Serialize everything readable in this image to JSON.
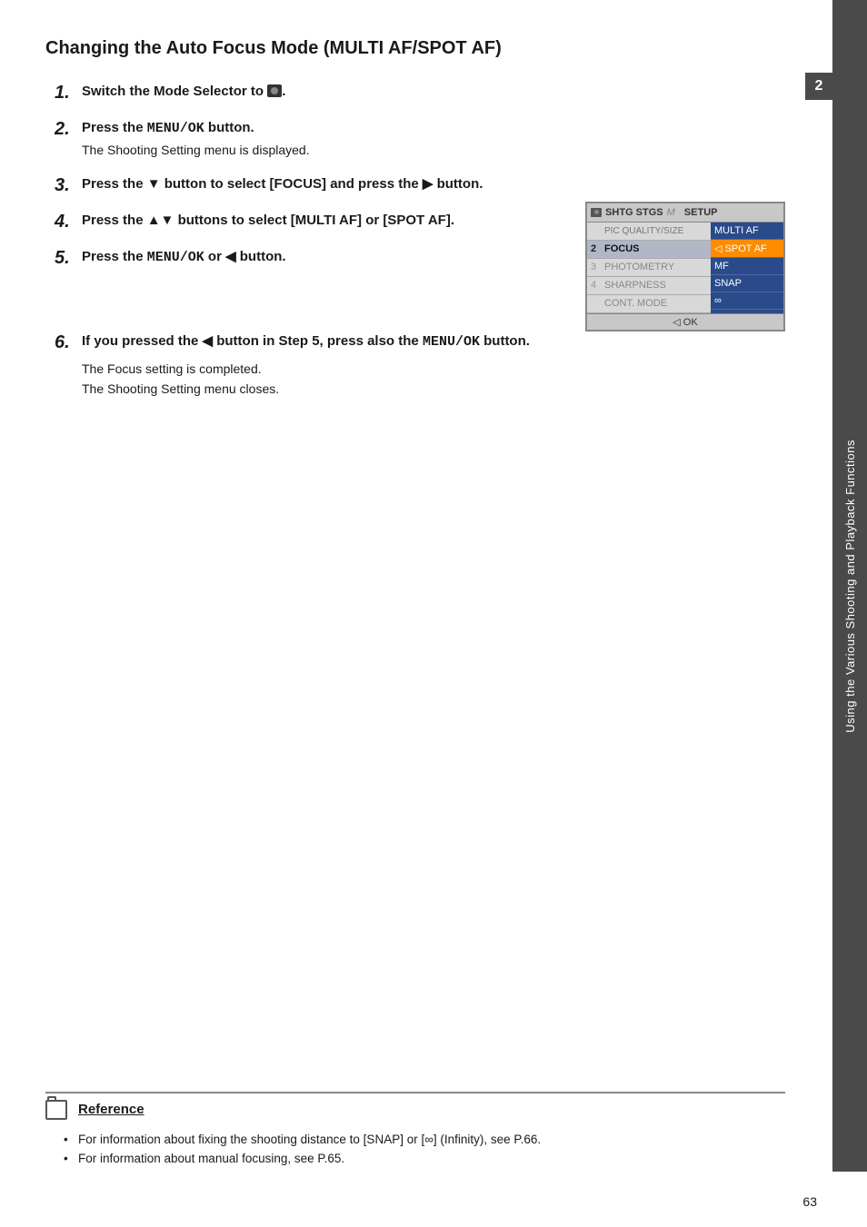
{
  "page": {
    "title": "Changing the Auto Focus Mode (MULTI AF/SPOT AF)",
    "page_number": "63",
    "sidebar_text": "Using the Various Shooting and Playback Functions",
    "sidebar_number": "2"
  },
  "steps": [
    {
      "number": "1.",
      "text": "Switch the Mode Selector to",
      "icon": "camera-still-icon",
      "suffix": "."
    },
    {
      "number": "2.",
      "main": "Press the",
      "mono": "MENU/OK",
      "suffix": " button.",
      "sub": "The Shooting Setting menu is displayed."
    },
    {
      "number": "3.",
      "text": "Press the ▼ button to select [FOCUS] and press the ▶ button."
    },
    {
      "number": "4.",
      "text": "Press the ▲▼ buttons to select [MULTI AF] or [SPOT AF]."
    },
    {
      "number": "5.",
      "main": "Press the",
      "mono": "MENU/OK",
      "or": " or ◀ button."
    },
    {
      "number": "6.",
      "main": "If you pressed the ◀ button in Step 5, press also the",
      "mono": "MENU/OK",
      "suffix": " button.",
      "sub1": "The Focus setting is completed.",
      "sub2": "The Shooting Setting menu closes."
    }
  ],
  "menu": {
    "header_tabs": [
      "SHTG STGS",
      "M",
      "SETUP"
    ],
    "rows_left": [
      {
        "num": "",
        "label": "PIC QUALITY/SIZE"
      },
      {
        "num": "2",
        "label": "FOCUS",
        "highlighted": true
      },
      {
        "num": "3",
        "label": "PHOTOMETRY"
      },
      {
        "num": "4",
        "label": "SHARPNESS"
      },
      {
        "num": "",
        "label": "CONT. MODE"
      }
    ],
    "rows_right": [
      {
        "label": "MULTI AF",
        "selected": false
      },
      {
        "label": "SPOT AF",
        "selected": true
      },
      {
        "label": "MF"
      },
      {
        "label": "SNAP"
      },
      {
        "label": "∞"
      }
    ],
    "footer": "◁ OK"
  },
  "reference": {
    "title": "Reference",
    "items": [
      "For information about fixing the shooting distance to [SNAP] or [∞] (Infinity), see P.66.",
      "For information about manual focusing, see P.65."
    ]
  }
}
